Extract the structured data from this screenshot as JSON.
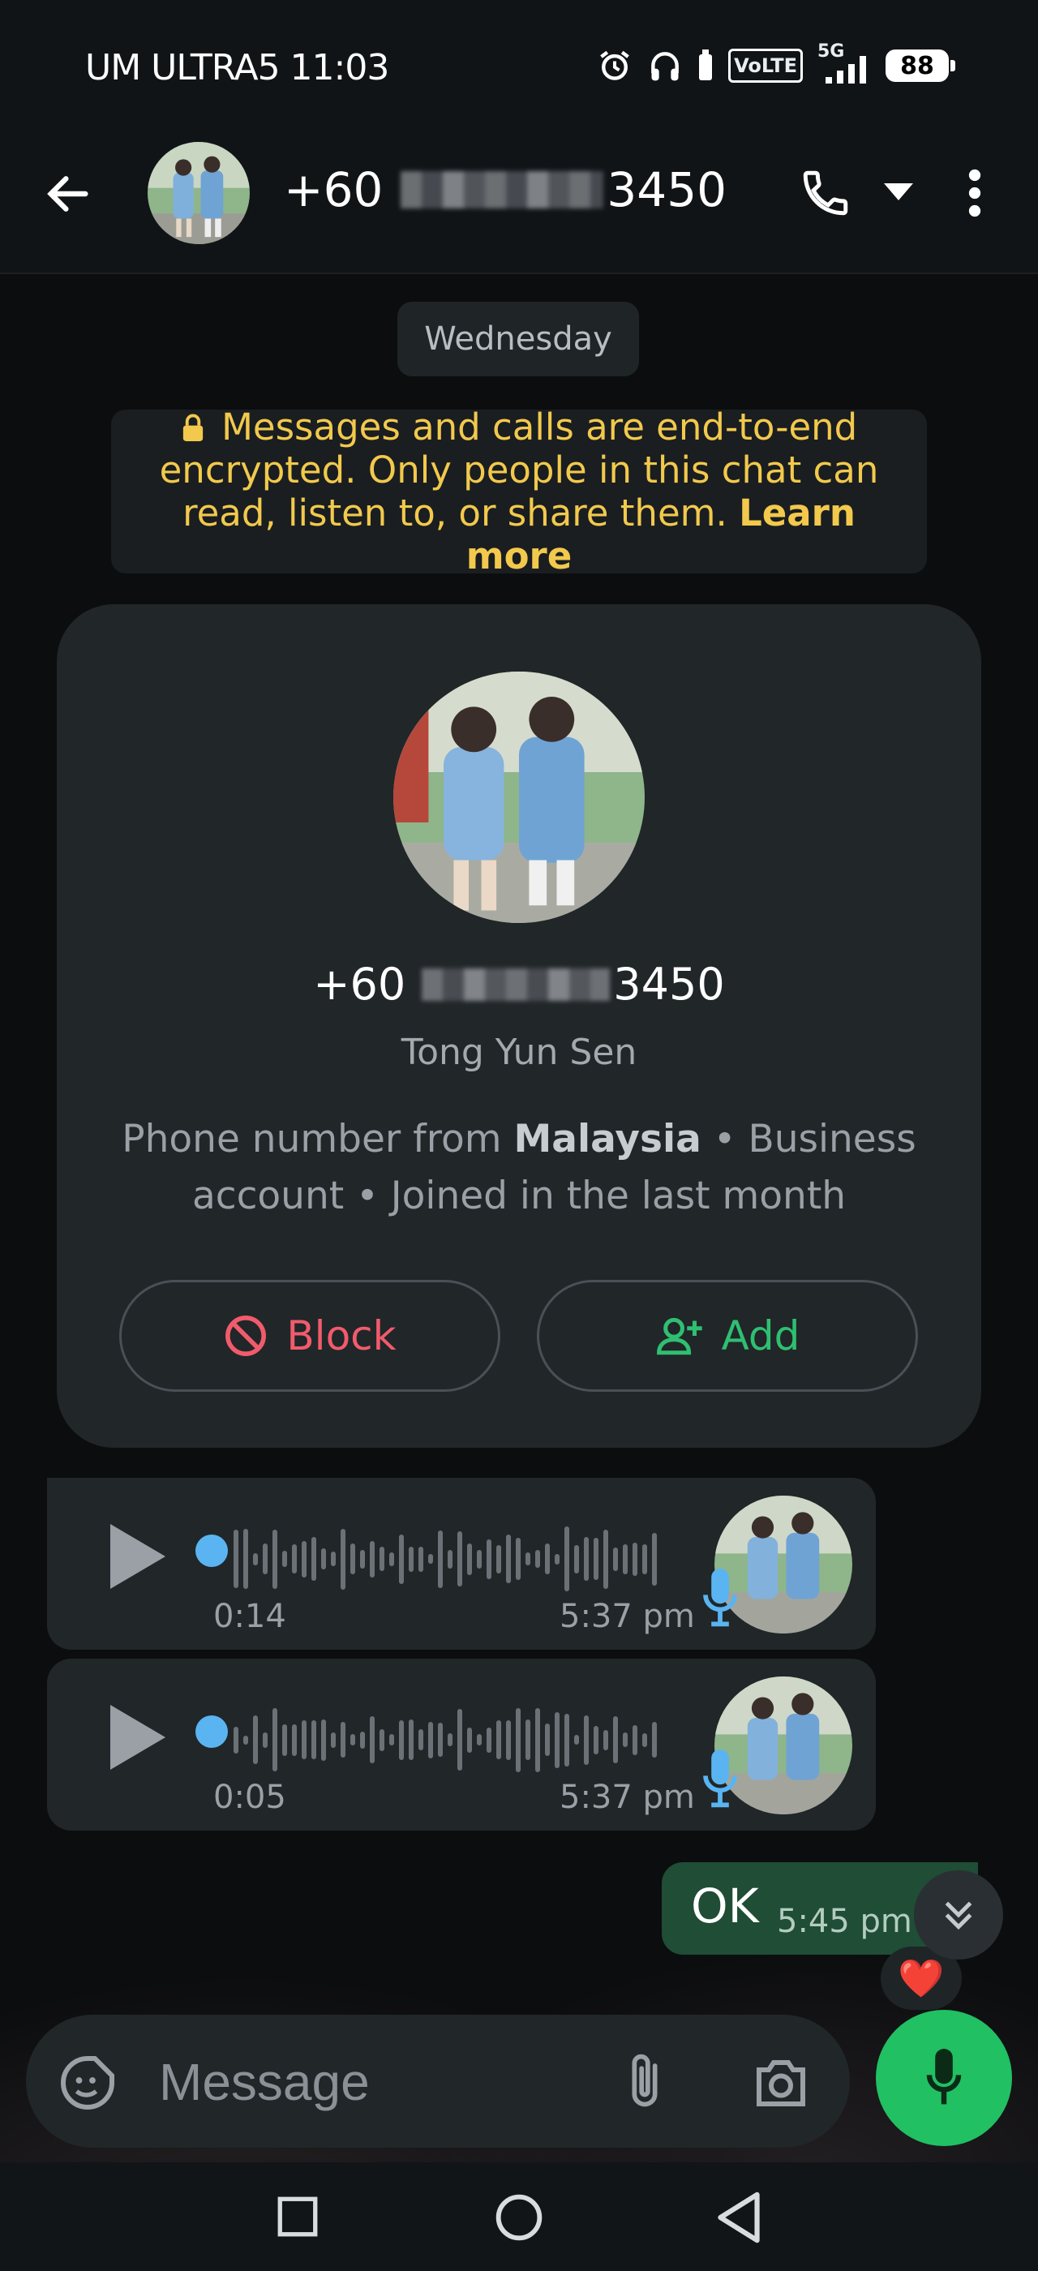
{
  "status_bar": {
    "carrier_time": "UM ULTRA5 11:03",
    "battery": "88",
    "volte": "VoLTE",
    "network": "5G"
  },
  "header": {
    "contact_prefix": "+60",
    "contact_suffix": "3450",
    "icons": [
      "back-arrow-icon",
      "phone-icon",
      "dropdown-icon",
      "more-vert-icon"
    ]
  },
  "chat": {
    "date_chip": "Wednesday",
    "encryption_note": {
      "text": "Messages and calls are end-to-end encrypted. Only people in this chat can read, listen to, or share them.",
      "link": "Learn more"
    }
  },
  "contact_card": {
    "phone_prefix": "+60",
    "phone_suffix": "3450",
    "name": "Tong Yun Sen",
    "desc_pre": "Phone number from",
    "country": "Malaysia",
    "desc_post": "• Business account • Joined in the last month",
    "block_label": "Block",
    "add_label": "Add"
  },
  "messages": [
    {
      "type": "voice",
      "duration": "0:14",
      "time": "5:37 pm"
    },
    {
      "type": "voice",
      "duration": "0:05",
      "time": "5:37 pm"
    },
    {
      "type": "text",
      "text": "OK",
      "time": "5:45 pm",
      "reaction": "❤️"
    }
  ],
  "composer": {
    "placeholder": "Message"
  },
  "colors": {
    "accent_green": "#21c063",
    "outgoing_bubble": "#1f4d36",
    "encryption_text": "#f2c94c",
    "block_red": "#f15b6c"
  }
}
